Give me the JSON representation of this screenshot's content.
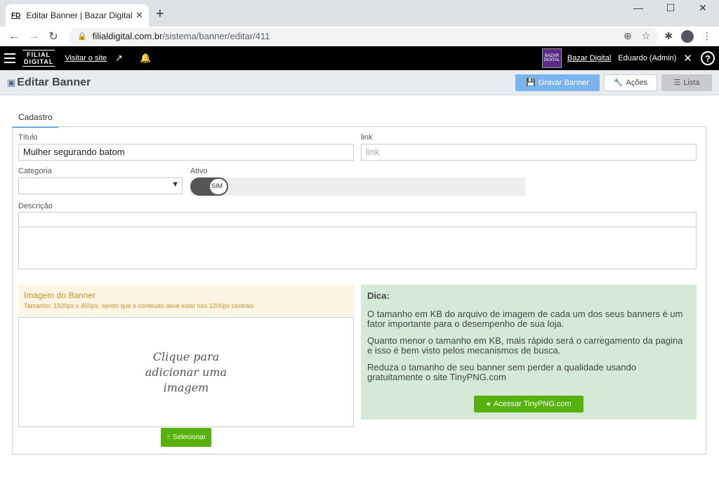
{
  "browser": {
    "tab_favicon": "FD",
    "tab_title": "Editar Banner | Bazar Digital",
    "url_domain": "filialdigital.com.br",
    "url_path": "/sistema/banner/editar/411"
  },
  "appbar": {
    "logo_top": "FILIAL",
    "logo_bottom": "DIGITAL",
    "visit_link": "Visitar o site",
    "store_logo_text": "BAZAR DIGITAL",
    "store_name": "Bazar Digital",
    "user": "Eduardo (Admin)"
  },
  "titlebar": {
    "title": "Editar Banner",
    "save_label": "Gravar Banner",
    "actions_label": "Ações",
    "list_label": "Lista"
  },
  "form": {
    "tab": "Cadastro",
    "titulo_label": "Título",
    "titulo_value": "Mulher segurando batom",
    "link_label": "link",
    "link_placeholder": "link",
    "categoria_label": "Categoria",
    "ativo_label": "Ativo",
    "ativo_value": "SIM",
    "descricao_label": "Descrição"
  },
  "image": {
    "heading": "Imagem do Banner",
    "size_hint": "Tamanho: 1920px x 450px, sendo que o conteudo deve estar nos 1200px centrais",
    "drop_text": "Clique para adicionar uma imagem",
    "select_label": "Selecionar"
  },
  "tip": {
    "title": "Dica:",
    "p1": "O tamanho em KB do arquivo de imagem de cada um dos seus banners é um fator importante para o desempenho de sua loja.",
    "p2": "Quanto menor o tamanho em KB, mais rápido será o carregamento da pagina e isso é bem visto pelos mecanismos de busca.",
    "p3": "Reduza o tamanho de seu banner sem perder a qualidade usando gratuitamente o site TinyPNG.com",
    "button_label": "Acessar TinyPNG.com"
  },
  "colors": {
    "accent_green": "#57b10d",
    "save_blue": "#7ab4ee",
    "tip_bg": "#d4ead7",
    "image_header_bg": "#fdf4e3"
  }
}
